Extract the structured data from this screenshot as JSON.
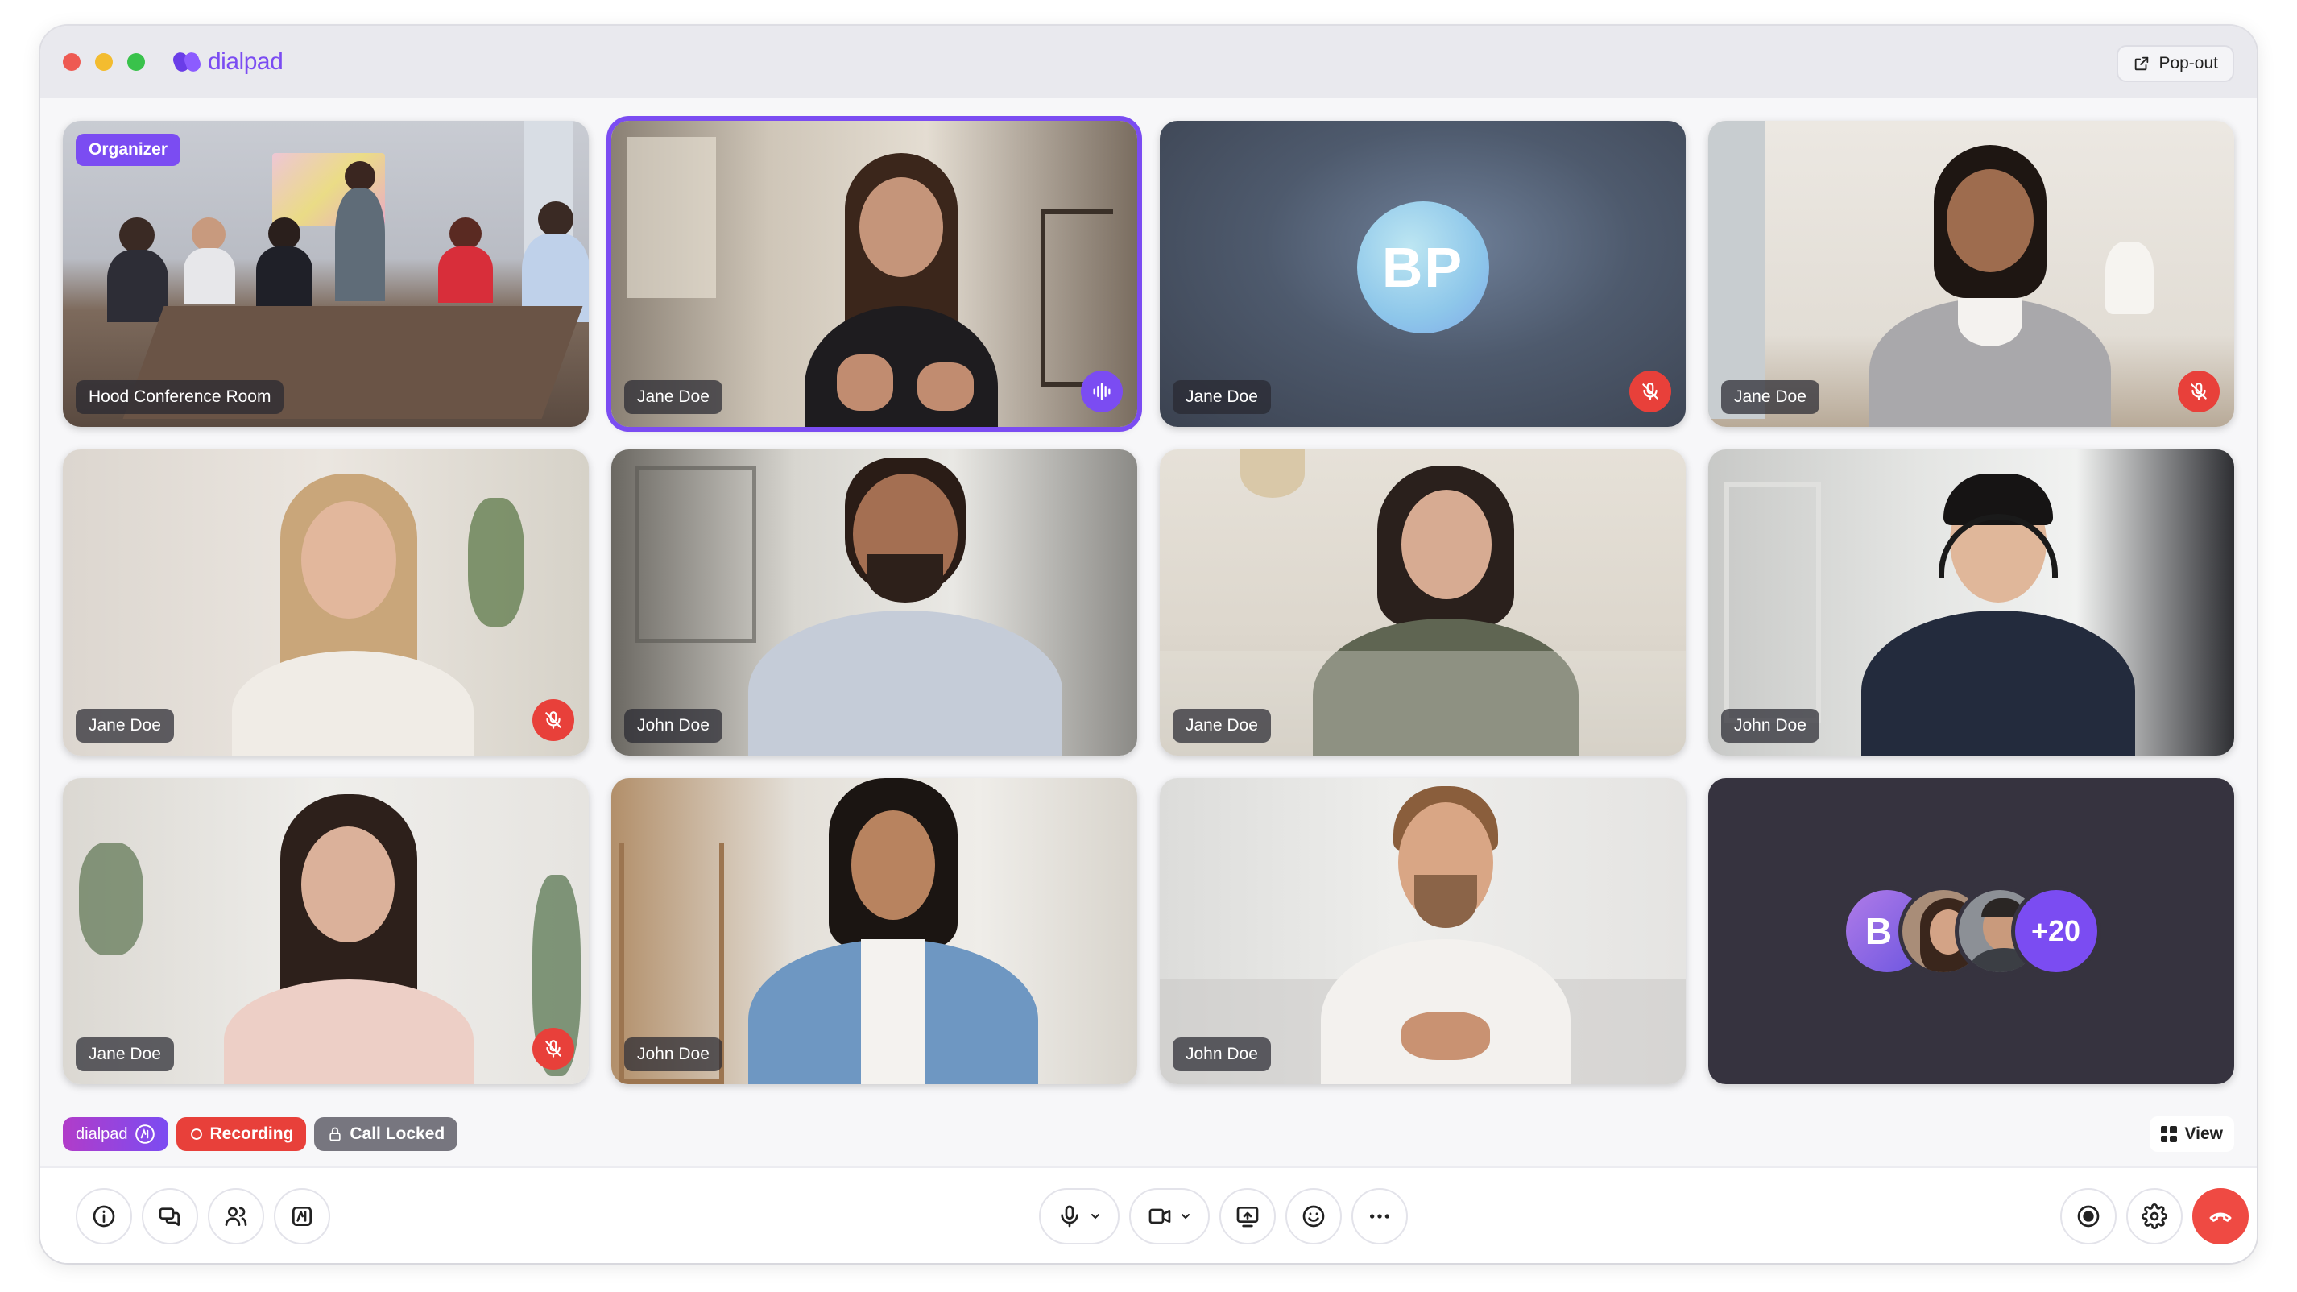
{
  "app": {
    "brand": "dialpad",
    "popout_label": "Pop-out"
  },
  "tiles": [
    {
      "name": "Hood Conference Room",
      "badge": "Organizer",
      "status": "none"
    },
    {
      "name": "Jane Doe",
      "status": "speaking",
      "active": true
    },
    {
      "name": "Jane Doe",
      "initials": "BP",
      "status": "muted"
    },
    {
      "name": "Jane Doe",
      "status": "muted"
    },
    {
      "name": "Jane Doe",
      "status": "muted"
    },
    {
      "name": "John Doe",
      "status": "none"
    },
    {
      "name": "Jane Doe",
      "status": "none"
    },
    {
      "name": "John Doe",
      "status": "none"
    },
    {
      "name": "Jane Doe",
      "status": "muted"
    },
    {
      "name": "John Doe",
      "status": "none"
    },
    {
      "name": "John Doe",
      "status": "none"
    }
  ],
  "overflow": {
    "first_initial": "B",
    "more_count": "+20"
  },
  "status_pills": {
    "ai": "dialpad",
    "recording": "Recording",
    "locked": "Call Locked"
  },
  "view_label": "View",
  "colors": {
    "accent": "#7b4cf2",
    "danger": "#e8403a",
    "locked": "#77767f"
  }
}
